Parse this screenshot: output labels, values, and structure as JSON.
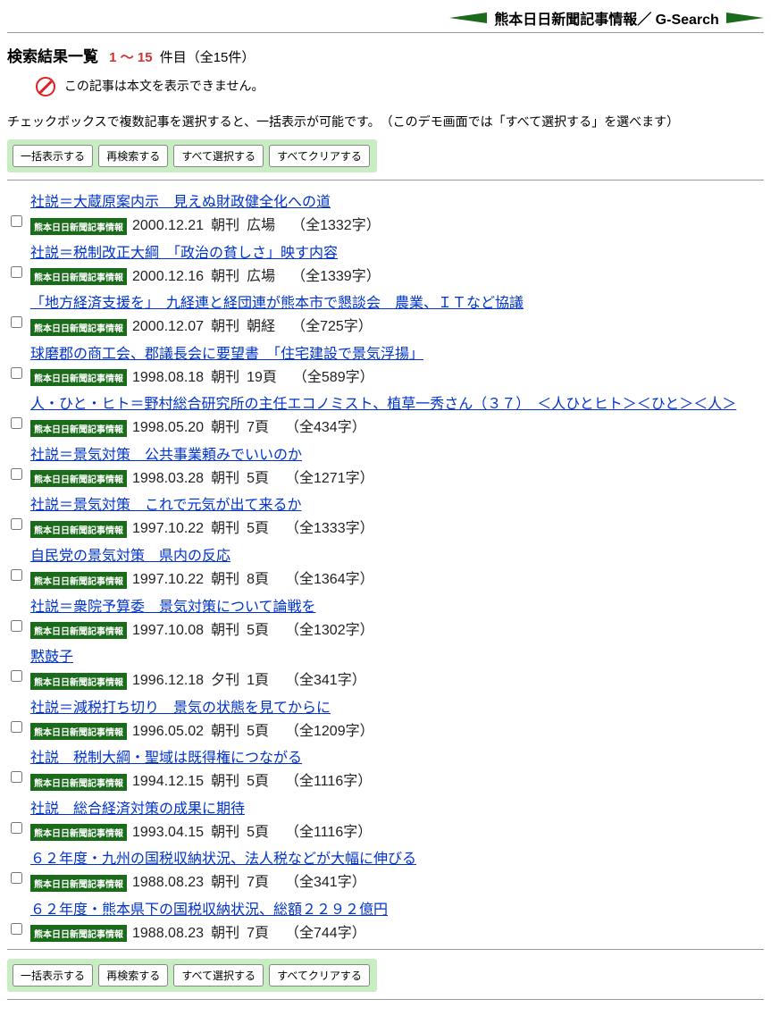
{
  "header": {
    "title": "熊本日日新聞記事情報／ G-Search"
  },
  "results_header": {
    "title": "検索結果一覧",
    "range": "1 〜 15",
    "count_suffix": "件目（全15件）"
  },
  "notice": "この記事は本文を表示できません。",
  "note": "チェックボックスで複数記事を選択すると、一括表示が可能です。　（このデモ画面では「すべて選択する」を選べます）",
  "buttons": {
    "batch_display": "一括表示する",
    "research": "再検索する",
    "select_all": "すべて選択する",
    "clear_all": "すべてクリアする"
  },
  "source_label": "熊本日日新聞記事情報",
  "results": [
    {
      "title": "社説＝大蔵原案内示　見えぬ財政健全化への道",
      "date": "2000.12.21",
      "edition": "朝刊",
      "page": "広場",
      "chars": "（全1332字）"
    },
    {
      "title": "社説＝税制改正大綱　「政治の貧しさ」映す内容",
      "date": "2000.12.16",
      "edition": "朝刊",
      "page": "広場",
      "chars": "（全1339字）"
    },
    {
      "title": "「地方経済支援を」　九経連と経団連が熊本市で懇談会　農業、ＩＴなど協議",
      "date": "2000.12.07",
      "edition": "朝刊",
      "page": "朝経",
      "chars": "（全725字）"
    },
    {
      "title": "球磨郡の商工会、郡議長会に要望書　「住宅建設で景気浮揚」",
      "date": "1998.08.18",
      "edition": "朝刊",
      "page": "19頁",
      "chars": "（全589字）"
    },
    {
      "title": "人・ひと・ヒト＝野村総合研究所の主任エコノミスト、植草一秀さん（３７）　＜人ひとヒト＞＜ひと＞＜人＞",
      "date": "1998.05.20",
      "edition": "朝刊",
      "page": "7頁",
      "chars": "（全434字）"
    },
    {
      "title": "社説＝景気対策　公共事業頼みでいいのか",
      "date": "1998.03.28",
      "edition": "朝刊",
      "page": "5頁",
      "chars": "（全1271字）"
    },
    {
      "title": "社説＝景気対策　これで元気が出て来るか",
      "date": "1997.10.22",
      "edition": "朝刊",
      "page": "5頁",
      "chars": "（全1333字）"
    },
    {
      "title": "自民党の景気対策　県内の反応",
      "date": "1997.10.22",
      "edition": "朝刊",
      "page": "8頁",
      "chars": "（全1364字）"
    },
    {
      "title": "社説＝衆院予算委　景気対策について論戦を",
      "date": "1997.10.08",
      "edition": "朝刊",
      "page": "5頁",
      "chars": "（全1302字）"
    },
    {
      "title": "黙鼓子",
      "date": "1996.12.18",
      "edition": "夕刊",
      "page": "1頁",
      "chars": "（全341字）"
    },
    {
      "title": "社説＝減税打ち切り　景気の状態を見てからに",
      "date": "1996.05.02",
      "edition": "朝刊",
      "page": "5頁",
      "chars": "（全1209字）"
    },
    {
      "title": "社説　税制大綱・聖域は既得権につながる",
      "date": "1994.12.15",
      "edition": "朝刊",
      "page": "5頁",
      "chars": "（全1116字）"
    },
    {
      "title": "社説　総合経済対策の成果に期待",
      "date": "1993.04.15",
      "edition": "朝刊",
      "page": "5頁",
      "chars": "（全1116字）"
    },
    {
      "title": "６２年度・九州の国税収納状況、法人税などが大幅に伸びる",
      "date": "1988.08.23",
      "edition": "朝刊",
      "page": "7頁",
      "chars": "（全341字）"
    },
    {
      "title": "６２年度・熊本県下の国税収納状況、総額２２９２億円",
      "date": "1988.08.23",
      "edition": "朝刊",
      "page": "7頁",
      "chars": "（全744字）"
    }
  ]
}
